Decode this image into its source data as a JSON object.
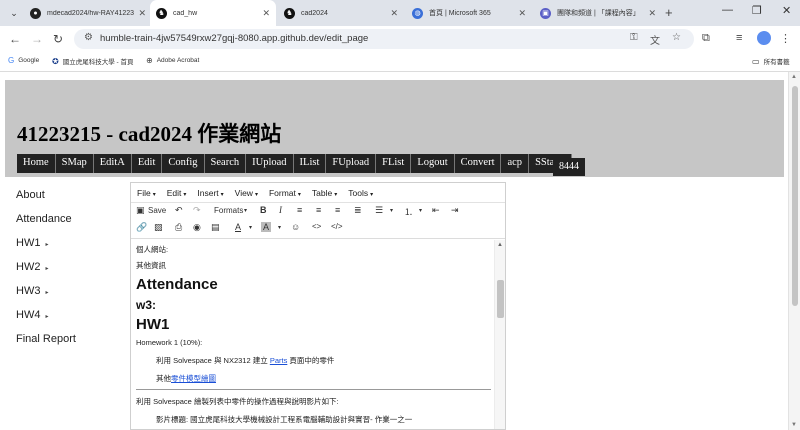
{
  "browser": {
    "tabs": [
      {
        "title": "mdecad2024/hw-RAY41223",
        "active": false,
        "fav_color": "#222"
      },
      {
        "title": "cad_hw",
        "active": true,
        "fav_color": "#111"
      },
      {
        "title": "cad2024",
        "active": false,
        "fav_color": "#111"
      },
      {
        "title": "首頁 | Microsoft 365",
        "active": false,
        "fav_color": "#3a6fd8"
      },
      {
        "title": "團隊和頻道 | 「課程內容」",
        "active": false,
        "fav_color": "#5b5fc7"
      }
    ],
    "url": "humble-train-4jw57549rxw27gqj-8080.app.github.dev/edit_page",
    "bookmarks": [
      "Google",
      "國立虎尾科技大學 - 首頁",
      "Adobe Acrobat"
    ],
    "all_bookmarks": "所有書籤"
  },
  "site": {
    "title": "41223215 - cad2024 作業網站",
    "menu": [
      "Home",
      "SMap",
      "EditA",
      "Edit",
      "Config",
      "Search",
      "IUpload",
      "IList",
      "FUpload",
      "FList",
      "Logout",
      "Convert",
      "acp",
      "SStatic"
    ],
    "port": "8444"
  },
  "sidebar": {
    "items": [
      {
        "label": "About",
        "has_children": false
      },
      {
        "label": "Attendance",
        "has_children": false
      },
      {
        "label": "HW1",
        "has_children": true
      },
      {
        "label": "HW2",
        "has_children": true
      },
      {
        "label": "HW3",
        "has_children": true
      },
      {
        "label": "HW4",
        "has_children": true
      },
      {
        "label": "Final Report",
        "has_children": false
      }
    ]
  },
  "editor": {
    "menu": [
      "File",
      "Edit",
      "Insert",
      "View",
      "Format",
      "Table",
      "Tools"
    ],
    "save_label": "Save",
    "formats_label": "Formats",
    "content": {
      "line1": "個人網站:",
      "line2": "其他資訊",
      "h_attendance": "Attendance",
      "h_w3": "w3:",
      "h_hw1": "HW1",
      "hw1_intro": "Homework 1 (10%):",
      "hw1_item1_prefix": "利用 Solvespace 與 NX2312 建立",
      "hw1_item1_link": "Parts",
      "hw1_item1_suffix": "頁面中的零件",
      "hw1_item2_prefix": "其他",
      "hw1_item2_link": "零件模型繪圖",
      "para_solvespace": "利用 Solvespace 繪製列表中零件的操作過程與說明影片如下:",
      "video_title": "影片標題: 國立虎尾科技大學機械設計工程系電腦輔助設計與實習- 作業一之一"
    }
  }
}
